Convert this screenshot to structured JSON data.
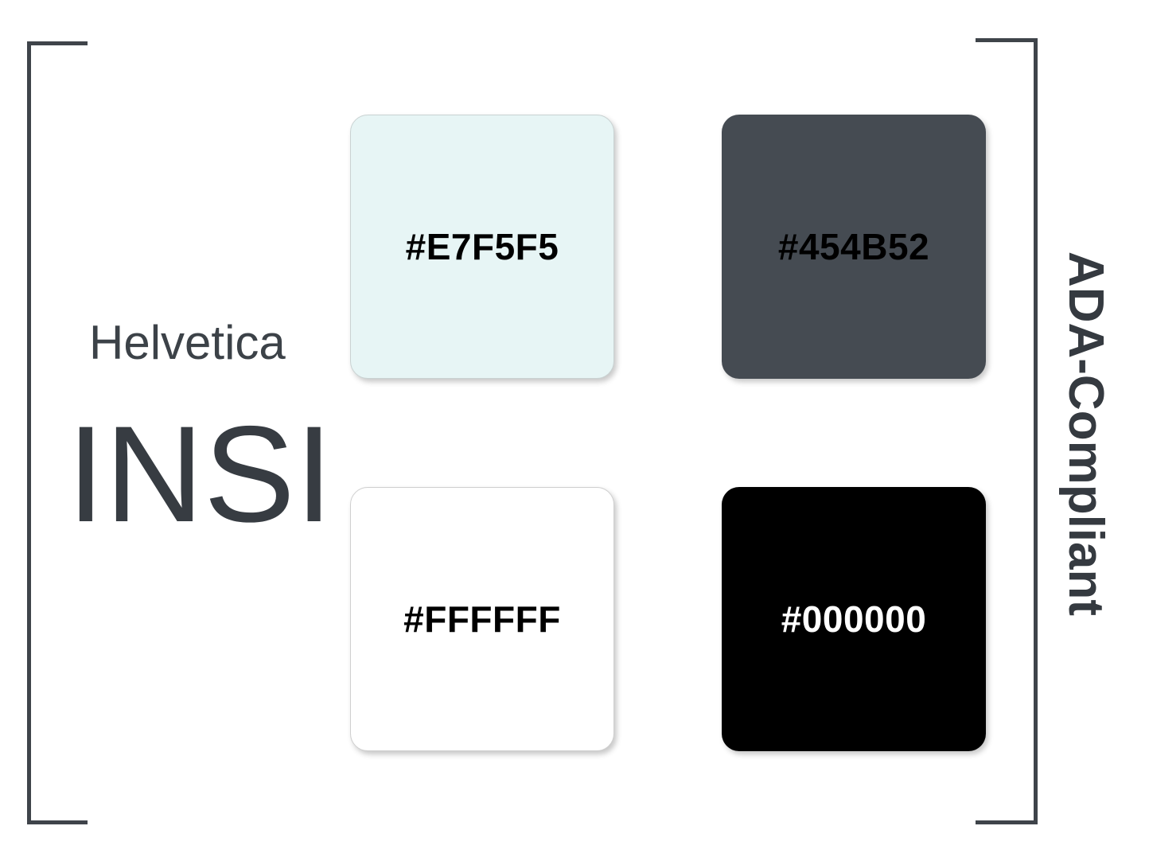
{
  "typography": {
    "font_name": "Helvetica",
    "brand": "INSI"
  },
  "swatches": [
    {
      "hex": "#E7F5F5",
      "label": "#E7F5F5",
      "text_color": "#000000"
    },
    {
      "hex": "#454B52",
      "label": "#454B52",
      "text_color": "#000000"
    },
    {
      "hex": "#FFFFFF",
      "label": "#FFFFFF",
      "text_color": "#000000"
    },
    {
      "hex": "#000000",
      "label": "#000000",
      "text_color": "#FFFFFF"
    }
  ],
  "side_label": "ADA-Compliant",
  "colors": {
    "bracket": "#3F444A",
    "heading_text": "#373C42"
  }
}
